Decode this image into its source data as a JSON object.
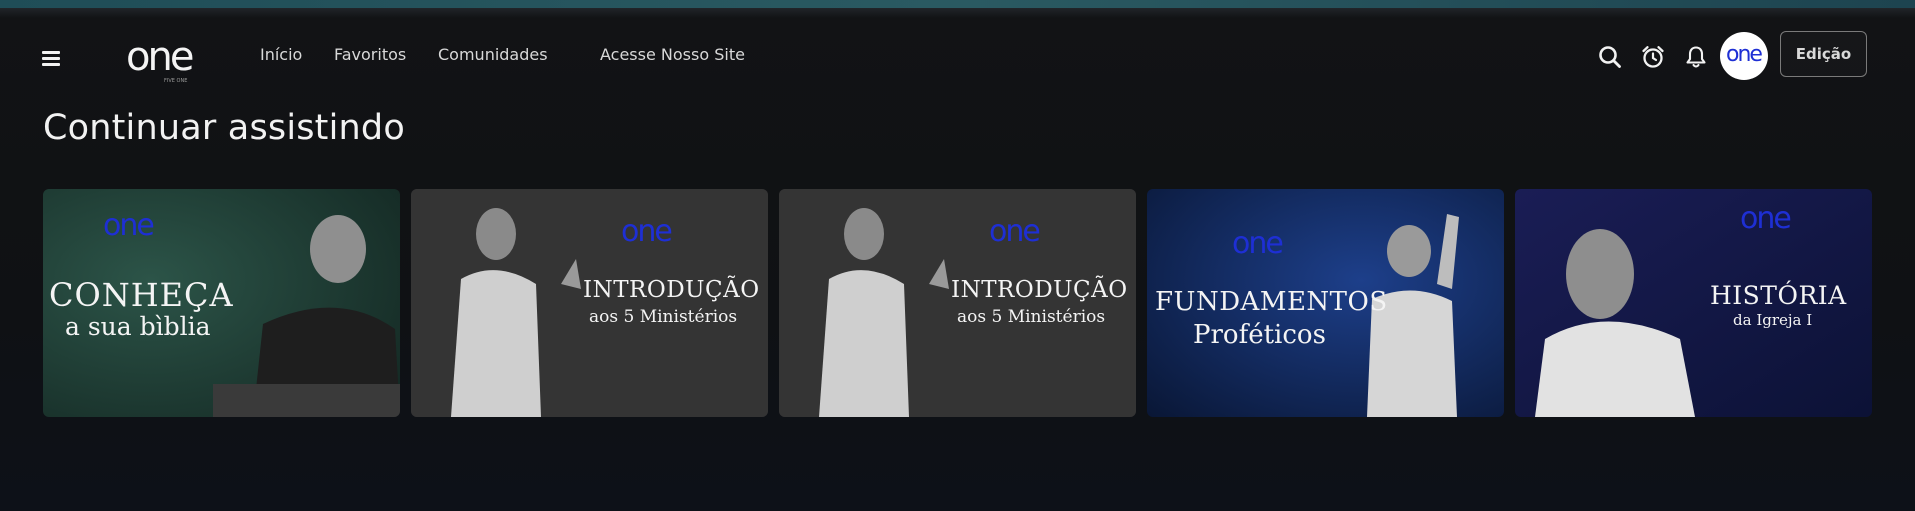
{
  "header": {
    "logo": {
      "text": "one",
      "subtext": "FIVE ONE"
    },
    "nav": [
      {
        "label": "Início"
      },
      {
        "label": "Favoritos"
      },
      {
        "label": "Comunidades"
      },
      {
        "label": "Acesse Nosso Site"
      }
    ],
    "icons": [
      "menu-icon",
      "search-icon",
      "alarm-clock-icon",
      "bell-icon"
    ],
    "avatar": {
      "text": "one"
    },
    "edit_button": "Edição"
  },
  "section": {
    "title": "Continuar assistindo",
    "cards": [
      {
        "brand": "one",
        "line1": "CONHEÇA",
        "line2": "a sua bìblia"
      },
      {
        "brand": "one",
        "line1": "INTRODUÇÃO",
        "line2": "aos 5 Ministérios"
      },
      {
        "brand": "one",
        "line1": "INTRODUÇÃO",
        "line2": "aos 5 Ministérios"
      },
      {
        "brand": "one",
        "line1": "FUNDAMENTOS",
        "line2": "Proféticos"
      },
      {
        "brand": "one",
        "line1": "HISTÓRIA",
        "line2": "da Igreja I"
      }
    ]
  },
  "colors": {
    "top_strip": "#2a5a62",
    "background": "#121315",
    "brand_blue": "#1e2fd4"
  }
}
